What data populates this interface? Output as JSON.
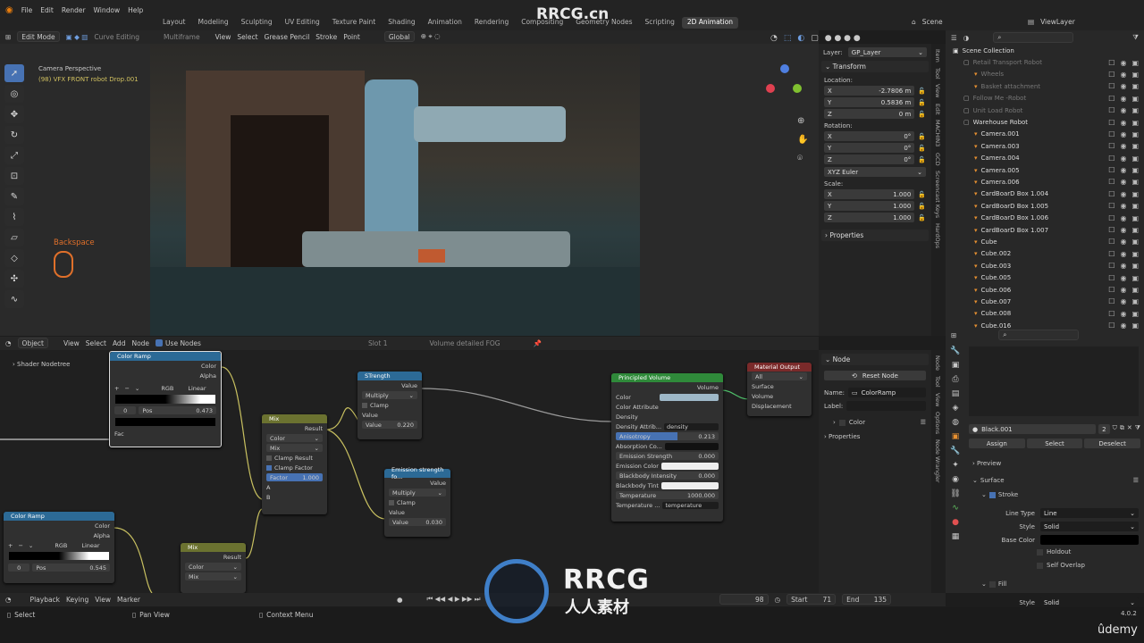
{
  "menu": [
    "File",
    "Edit",
    "Render",
    "Window",
    "Help"
  ],
  "workspace_tabs": [
    "Layout",
    "Modeling",
    "Sculpting",
    "UV Editing",
    "Texture Paint",
    "Shading",
    "Animation",
    "Rendering",
    "Compositing",
    "Geometry Nodes",
    "Scripting",
    "2D Animation"
  ],
  "scene": "Scene",
  "viewlayer": "ViewLayer",
  "viewport_header": {
    "mode": "Edit Mode",
    "curve_editing": "Curve Editing",
    "multiframe": "Multiframe",
    "items": [
      "View",
      "Select",
      "Grease Pencil",
      "Stroke",
      "Point"
    ],
    "orientation": "Global"
  },
  "viewport": {
    "camera_label": "Camera Perspective",
    "object_label": "(98) VFX FRONT robot Drop.001",
    "key_hint": "Backspace"
  },
  "npanel": {
    "layer_label": "Layer:",
    "layer": "GP_Layer",
    "transform": "Transform",
    "location": "Location:",
    "loc": [
      {
        "axis": "X",
        "value": "-2.7806 m"
      },
      {
        "axis": "Y",
        "value": "0.5836 m"
      },
      {
        "axis": "Z",
        "value": "0 m"
      }
    ],
    "rotation": "Rotation:",
    "rot": [
      {
        "axis": "X",
        "value": "0°"
      },
      {
        "axis": "Y",
        "value": "0°"
      },
      {
        "axis": "Z",
        "value": "0°"
      }
    ],
    "euler": "XYZ Euler",
    "scale": "Scale:",
    "scl": [
      {
        "axis": "X",
        "value": "1.000"
      },
      {
        "axis": "Y",
        "value": "1.000"
      },
      {
        "axis": "Z",
        "value": "1.000"
      }
    ],
    "properties": "Properties"
  },
  "sidetabs": [
    "Item",
    "Tool",
    "View",
    "Edit",
    "MACHIN3",
    "GCD",
    "Screencast Keys",
    "HardOps"
  ],
  "outliner": {
    "title": "Scene Collection",
    "items": [
      {
        "name": "Retail Transport Robot",
        "indent": 1,
        "dim": true
      },
      {
        "name": "Wheels",
        "indent": 2,
        "dim": true
      },
      {
        "name": "Basket attachment",
        "indent": 2,
        "dim": true
      },
      {
        "name": "Follow Me -Robot",
        "indent": 1,
        "dim": true
      },
      {
        "name": "Unit Load Robot",
        "indent": 1,
        "dim": true
      },
      {
        "name": "Warehouse Robot",
        "indent": 1,
        "dim": false
      },
      {
        "name": "Camera.001",
        "indent": 2,
        "dim": false
      },
      {
        "name": "Camera.003",
        "indent": 2,
        "dim": false
      },
      {
        "name": "Camera.004",
        "indent": 2,
        "dim": false
      },
      {
        "name": "Camera.005",
        "indent": 2,
        "dim": false
      },
      {
        "name": "Camera.006",
        "indent": 2,
        "dim": false
      },
      {
        "name": "CardBoarD Box 1.004",
        "indent": 2,
        "dim": false
      },
      {
        "name": "CardBoarD Box 1.005",
        "indent": 2,
        "dim": false
      },
      {
        "name": "CardBoarD Box 1.006",
        "indent": 2,
        "dim": false
      },
      {
        "name": "CardBoarD Box 1.007",
        "indent": 2,
        "dim": false
      },
      {
        "name": "Cube",
        "indent": 2,
        "dim": false
      },
      {
        "name": "Cube.002",
        "indent": 2,
        "dim": false
      },
      {
        "name": "Cube.003",
        "indent": 2,
        "dim": false
      },
      {
        "name": "Cube.005",
        "indent": 2,
        "dim": false
      },
      {
        "name": "Cube.006",
        "indent": 2,
        "dim": false
      },
      {
        "name": "Cube.007",
        "indent": 2,
        "dim": false
      },
      {
        "name": "Cube.008",
        "indent": 2,
        "dim": false
      },
      {
        "name": "Cube.016",
        "indent": 2,
        "dim": false
      }
    ]
  },
  "node_header": {
    "object": "Object",
    "items": [
      "View",
      "Select",
      "Add",
      "Node"
    ],
    "use_nodes": "Use Nodes",
    "slot": "Slot 1",
    "material": "Volume detailed FOG"
  },
  "node_editor": {
    "tree": "Shader Nodetree",
    "colorramp1": {
      "title": "Color Ramp",
      "out1": "Color",
      "out2": "Alpha",
      "mode": "RGB",
      "interp": "Linear",
      "index": "0",
      "pos_label": "Pos",
      "pos": "0.473",
      "in": "Fac"
    },
    "colorramp2": {
      "title": "Color Ramp",
      "out1": "Color",
      "out2": "Alpha",
      "mode": "RGB",
      "interp": "Linear",
      "index": "0",
      "pos_label": "Pos",
      "pos": "0.545"
    },
    "strength": {
      "title": "STrength",
      "out": "Value",
      "op": "Multiply",
      "clamp": "Clamp",
      "in": "Value",
      "val_label": "Value",
      "val": "0.220"
    },
    "mix1": {
      "title": "Mix",
      "out": "Result",
      "type": "Color",
      "blend": "Mix",
      "clamp_result": "Clamp Result",
      "clamp_factor": "Clamp Factor",
      "factor_label": "Factor",
      "factor": "1.000",
      "a": "A",
      "b": "B"
    },
    "mix2": {
      "title": "Mix",
      "out": "Result",
      "type": "Color",
      "blend": "Mix"
    },
    "emission": {
      "title": "Emission strength fo...",
      "out": "Value",
      "op": "Multiply",
      "clamp": "Clamp",
      "in": "Value",
      "val_label": "Value",
      "val": "0.030"
    },
    "principled": {
      "title": "Principled Volume",
      "out": "Volume",
      "rows": [
        {
          "label": "Color",
          "value": "",
          "kind": "color"
        },
        {
          "label": "Color Attribute",
          "value": "",
          "kind": "plain"
        },
        {
          "label": "Density",
          "value": "",
          "kind": "plain"
        },
        {
          "label": "Density Attrib...",
          "value": "density",
          "kind": "text"
        },
        {
          "label": "Anisotropy",
          "value": "0.213",
          "kind": "slider"
        },
        {
          "label": "Absorption Co...",
          "value": "",
          "kind": "dark"
        },
        {
          "label": "Emission Strength",
          "value": "0.000",
          "kind": "num"
        },
        {
          "label": "Emission Color",
          "value": "",
          "kind": "white"
        },
        {
          "label": "Blackbody Intensity",
          "value": "0.000",
          "kind": "num"
        },
        {
          "label": "Blackbody Tint",
          "value": "",
          "kind": "white"
        },
        {
          "label": "Temperature",
          "value": "1000.000",
          "kind": "num"
        },
        {
          "label": "Temperature ...",
          "value": "temperature",
          "kind": "text"
        }
      ]
    },
    "output": {
      "title": "Material Output",
      "target": "All",
      "in": [
        "Surface",
        "Volume",
        "Displacement"
      ]
    }
  },
  "node_side": {
    "panel": "Node",
    "reset": "Reset Node",
    "name_label": "Name:",
    "name": "ColorRamp",
    "label_label": "Label:",
    "color": "Color",
    "properties": "Properties"
  },
  "node_sidetabs": [
    "Node",
    "Tool",
    "View",
    "Options",
    "Node Wrangler"
  ],
  "props": {
    "material": "Black.001",
    "users": "2",
    "assign": "Assign",
    "select": "Select",
    "deselect": "Deselect",
    "preview": "Preview",
    "surface": "Surface",
    "stroke": "Stroke",
    "line_type_label": "Line Type",
    "line_type": "Line",
    "style_label": "Style",
    "style": "Solid",
    "base_color_label": "Base Color",
    "holdout": "Holdout",
    "self_overlap": "Self Overlap",
    "fill": "Fill",
    "fill_style": "Solid"
  },
  "timeline": {
    "items": [
      "Playback",
      "Keying",
      "View",
      "Marker"
    ],
    "frame": "98",
    "start_label": "Start",
    "start": "71",
    "end_label": "End",
    "end": "135"
  },
  "status": {
    "select": "Select",
    "pan": "Pan View",
    "context": "Context Menu",
    "version": "4.0.2"
  },
  "watermark": {
    "brand": "RRCG.cn",
    "logo": "RRCG",
    "logo_sub": "人人素材",
    "udemy": "ûdemy"
  },
  "colors": {
    "accent": "#4772b3",
    "node_converter": "#2c6a96",
    "node_mix": "#6b7230",
    "node_shader": "#2f8a3a",
    "node_output": "#7a2a2a"
  }
}
